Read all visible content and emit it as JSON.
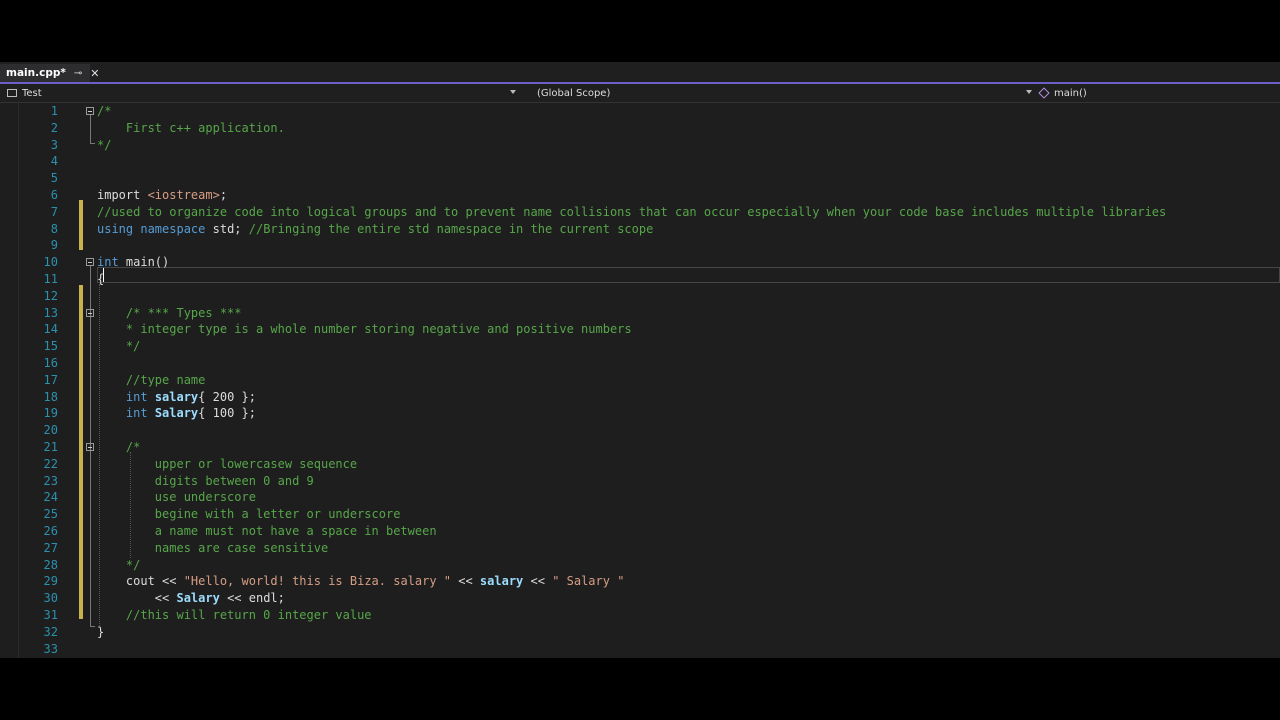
{
  "tab": {
    "title": "main.cpp*",
    "pin_icon": "pin-icon",
    "close_icon": "close-icon"
  },
  "navbar": {
    "project": "Test",
    "scope": "(Global Scope)",
    "member": "main()"
  },
  "editor": {
    "line_numbers": [
      "1",
      "2",
      "3",
      "4",
      "5",
      "6",
      "7",
      "8",
      "9",
      "10",
      "11",
      "12",
      "13",
      "14",
      "15",
      "16",
      "17",
      "18",
      "19",
      "20",
      "21",
      "22",
      "23",
      "24",
      "25",
      "26",
      "27",
      "28",
      "29",
      "30",
      "31",
      "32",
      "33"
    ],
    "lines": {
      "l1": "/*",
      "l2": "    First c++ application.",
      "l3": "*/",
      "l6a": "import ",
      "l6b": "<iostream>",
      "l6c": ";",
      "l7": "//used to organize code into logical groups and to prevent name collisions that can occur especially when your code base includes multiple libraries",
      "l8a": "using",
      "l8b": " ",
      "l8c": "namespace",
      "l8d": " std; ",
      "l8e": "//Bringing the entire std namespace in the current scope",
      "l10a": "int",
      "l10b": " main()",
      "l11": "{",
      "l13": "    /* *** Types ***",
      "l14": "    * integer type is a whole number storing negative and positive numbers",
      "l15": "    */",
      "l17": "    //type name",
      "l18a": "    int",
      "l18b": " ",
      "l18c": "salary",
      "l18d": "{ 200 };",
      "l19a": "    int",
      "l19b": " ",
      "l19c": "Salary",
      "l19d": "{ 100 };",
      "l21": "    /*",
      "l22": "        upper or lowercasew sequence",
      "l23": "        digits between 0 and 9",
      "l24": "        use underscore",
      "l25": "        begine with a letter or underscore",
      "l26": "        a name must not have a space in between",
      "l27": "        names are case sensitive",
      "l28": "    */",
      "l29a": "    cout << ",
      "l29b": "\"Hello, world! this is Biza. salary \"",
      "l29c": " << ",
      "l29d": "salary",
      "l29e": " << ",
      "l29f": "\" Salary \"",
      "l30a": "        << ",
      "l30b": "Salary",
      "l30c": " << endl;",
      "l31": "    //this will return 0 integer value",
      "l32": "}"
    }
  },
  "colors": {
    "comment": "#57a64a",
    "keyword": "#569cd6",
    "string": "#d69d85",
    "variable": "#9cdcfe",
    "line_number": "#2b91af",
    "accent": "#6c5fc7",
    "modified_margin": "#c9b24e"
  }
}
